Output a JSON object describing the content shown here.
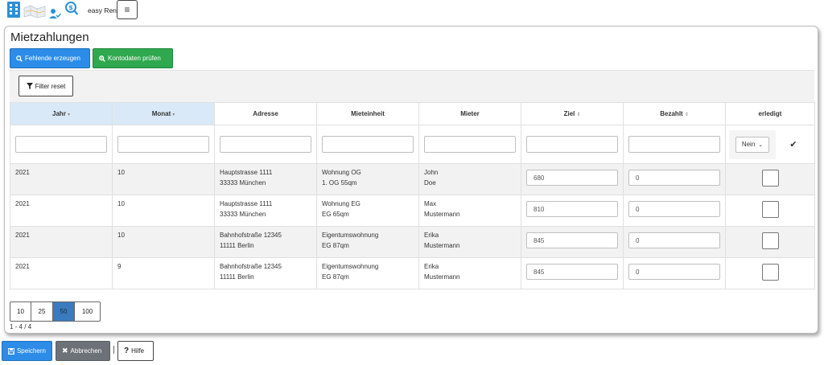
{
  "header": {
    "brand": "easy Rent",
    "menu_icon": "hamburger-icon"
  },
  "page": {
    "title": "Mietzahlungen"
  },
  "toolbar": {
    "missing_label": "Fehlende erzeugen",
    "check_label": "Kontodaten prüfen",
    "filter_reset_label": "Filter reset"
  },
  "table": {
    "columns": [
      "Jahr",
      "Monat",
      "Adresse",
      "Mieteinheit",
      "Mieter",
      "Ziel",
      "Bezahlt",
      "erledigt"
    ],
    "erledigt_filter": "Nein",
    "rows": [
      {
        "jahr": "2021",
        "monat": "10",
        "adresse1": "Hauptstrasse 1111",
        "adresse2": "33333 München",
        "einheit1": "Wohnung OG",
        "einheit2": "1. OG 55qm",
        "mieter1": "John",
        "mieter2": "Doe",
        "ziel": "680",
        "bezahlt": "0"
      },
      {
        "jahr": "2021",
        "monat": "10",
        "adresse1": "Hauptstrasse 1111",
        "adresse2": "33333 München",
        "einheit1": "Wohnung EG",
        "einheit2": "EG 65qm",
        "mieter1": "Max",
        "mieter2": "Mustermann",
        "ziel": "810",
        "bezahlt": "0"
      },
      {
        "jahr": "2021",
        "monat": "10",
        "adresse1": "Bahnhofstraße 12345",
        "adresse2": "11111 Berlin",
        "einheit1": "Eigentumswohnung",
        "einheit2": "EG 87qm",
        "mieter1": "Erika",
        "mieter2": "Mustermann",
        "ziel": "845",
        "bezahlt": "0"
      },
      {
        "jahr": "2021",
        "monat": "9",
        "adresse1": "Bahnhofstraße 12345",
        "adresse2": "11111 Berlin",
        "einheit1": "Eigentumswohnung",
        "einheit2": "EG 87qm",
        "mieter1": "Erika",
        "mieter2": "Mustermann",
        "ziel": "845",
        "bezahlt": "0"
      }
    ]
  },
  "pagination": {
    "sizes": [
      "10",
      "25",
      "50",
      "100"
    ],
    "active": "50",
    "range": "1 - 4 / 4"
  },
  "footer": {
    "save_label": "Speichern",
    "cancel_label": "Abbrechen",
    "help_label": "Hilfe"
  }
}
